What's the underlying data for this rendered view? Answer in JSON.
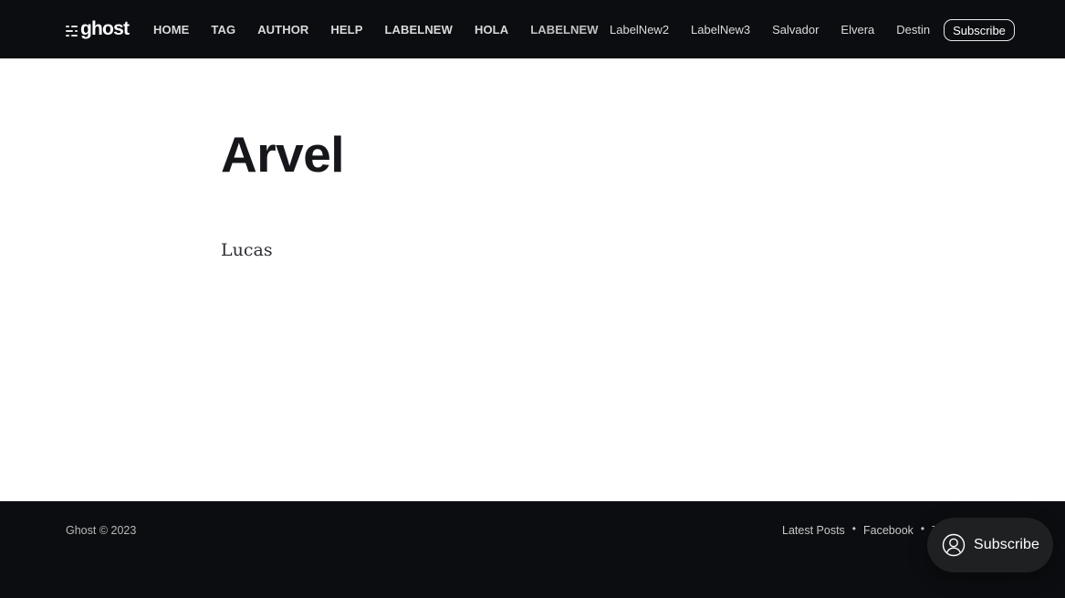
{
  "header": {
    "logo_text": "ghost",
    "primary_nav": [
      "HOME",
      "TAG",
      "AUTHOR",
      "HELP",
      "LABELNEW",
      "HOLA",
      "LABELNEW"
    ],
    "secondary_nav": [
      "LabelNew2",
      "LabelNew3",
      "Salvador",
      "Elvera",
      "Destin"
    ],
    "subscribe_label": "Subscribe"
  },
  "main": {
    "title": "Arvel",
    "body": "Lucas"
  },
  "footer": {
    "copyright": "Ghost © 2023",
    "links": [
      "Latest Posts",
      "Facebook"
    ],
    "truncated_link": "T"
  },
  "portal": {
    "label": "Subscribe",
    "icon": "user-circle-icon"
  },
  "colors": {
    "header_bg": "#0c0d10",
    "footer_bg": "#0c0d10",
    "page_bg": "#ffffff",
    "title_color": "#15171a",
    "portal_bg": "#1f2022"
  }
}
